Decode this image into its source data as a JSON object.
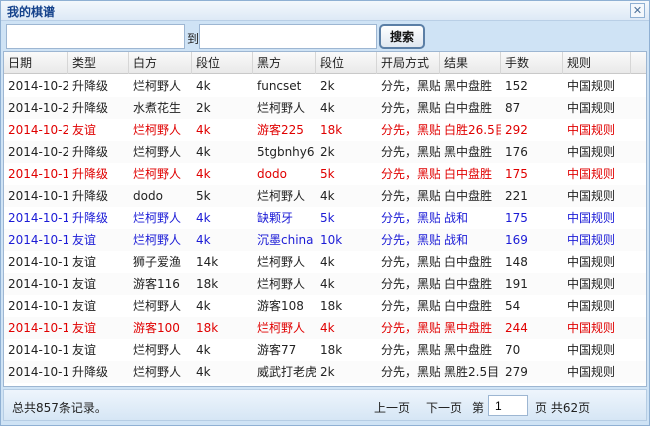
{
  "window": {
    "title": "我的棋谱",
    "close_glyph": "✕"
  },
  "search": {
    "start_value": "",
    "to_label": "到",
    "end_value": "",
    "button_label": "搜索"
  },
  "table": {
    "headers": [
      "日期",
      "类型",
      "白方",
      "段位",
      "黑方",
      "段位",
      "开局方式",
      "结果",
      "手数",
      "规则"
    ],
    "rows": [
      {
        "color": "black",
        "cells": [
          "2014-10-2",
          "升降级",
          "烂柯野人",
          "4k",
          "funcset",
          "2k",
          "分先，黑贴",
          "黑中盘胜",
          "152",
          "中国规则"
        ]
      },
      {
        "color": "black",
        "cells": [
          "2014-10-2",
          "升降级",
          "水煮花生",
          "2k",
          "烂柯野人",
          "4k",
          "分先，黑贴",
          "白中盘胜",
          "87",
          "中国规则"
        ]
      },
      {
        "color": "red",
        "cells": [
          "2014-10-2",
          "友谊",
          "烂柯野人",
          "4k",
          "游客225",
          "18k",
          "分先，黑贴",
          "白胜26.5目",
          "292",
          "中国规则"
        ]
      },
      {
        "color": "black",
        "cells": [
          "2014-10-2",
          "升降级",
          "烂柯野人",
          "4k",
          "5tgbnhy6",
          "2k",
          "分先，黑贴",
          "黑中盘胜",
          "176",
          "中国规则"
        ]
      },
      {
        "color": "red",
        "cells": [
          "2014-10-1",
          "升降级",
          "烂柯野人",
          "4k",
          "dodo",
          "5k",
          "分先，黑贴",
          "白中盘胜",
          "175",
          "中国规则"
        ]
      },
      {
        "color": "black",
        "cells": [
          "2014-10-1",
          "升降级",
          "dodo",
          "5k",
          "烂柯野人",
          "4k",
          "分先，黑贴",
          "白中盘胜",
          "221",
          "中国规则"
        ]
      },
      {
        "color": "blue",
        "cells": [
          "2014-10-1",
          "升降级",
          "烂柯野人",
          "4k",
          "缺颗牙",
          "5k",
          "分先，黑贴",
          "战和",
          "175",
          "中国规则"
        ]
      },
      {
        "color": "blue",
        "cells": [
          "2014-10-1",
          "友谊",
          "烂柯野人",
          "4k",
          "沉墨china",
          "10k",
          "分先，黑贴",
          "战和",
          "169",
          "中国规则"
        ]
      },
      {
        "color": "black",
        "cells": [
          "2014-10-1",
          "友谊",
          "狮子爱渔",
          "14k",
          "烂柯野人",
          "4k",
          "分先，黑贴",
          "白中盘胜",
          "148",
          "中国规则"
        ]
      },
      {
        "color": "black",
        "cells": [
          "2014-10-1",
          "友谊",
          "游客116",
          "18k",
          "烂柯野人",
          "4k",
          "分先，黑贴",
          "白中盘胜",
          "191",
          "中国规则"
        ]
      },
      {
        "color": "black",
        "cells": [
          "2014-10-1",
          "友谊",
          "烂柯野人",
          "4k",
          "游客108",
          "18k",
          "分先，黑贴",
          "白中盘胜",
          "54",
          "中国规则"
        ]
      },
      {
        "color": "red",
        "cells": [
          "2014-10-1",
          "友谊",
          "游客100",
          "18k",
          "烂柯野人",
          "4k",
          "分先，黑贴",
          "黑中盘胜",
          "244",
          "中国规则"
        ]
      },
      {
        "color": "black",
        "cells": [
          "2014-10-1",
          "友谊",
          "烂柯野人",
          "4k",
          "游客77",
          "18k",
          "分先，黑贴",
          "黑中盘胜",
          "70",
          "中国规则"
        ]
      },
      {
        "color": "black",
        "cells": [
          "2014-10-1",
          "升降级",
          "烂柯野人",
          "4k",
          "威武打老虎",
          "2k",
          "分先，黑贴",
          "黑胜2.5目",
          "279",
          "中国规则"
        ]
      }
    ]
  },
  "status": {
    "total": "总共857条记录。",
    "prev": "上一页",
    "next": "下一页",
    "page_prefix": "第",
    "page_value": "1",
    "page_suffix": "页 共62页"
  },
  "colors": {
    "black": "#222222",
    "red": "#e00000",
    "blue": "#1b1bd6"
  }
}
